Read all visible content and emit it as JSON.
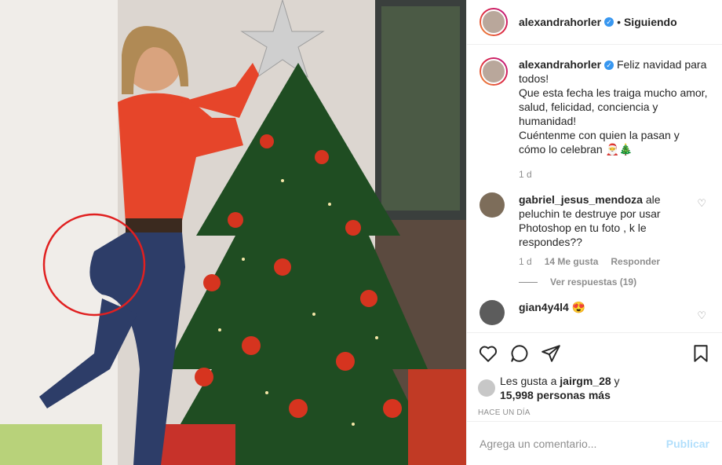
{
  "photo": {
    "alt": ""
  },
  "header": {
    "username": "alexandrahorler",
    "verified_icon": "verified-badge-icon",
    "separator": "•",
    "follow_label": "Siguiendo"
  },
  "caption": {
    "username": "alexandrahorler",
    "lines": [
      "Feliz navidad para",
      "todos!",
      "Que esta fecha les traiga mucho amor,",
      "salud, felicidad, conciencia y",
      "humanidad!",
      "Cuéntenme con quien la pasan y",
      "cómo lo celebran 🎅🎄"
    ],
    "time": "1 d"
  },
  "comments": [
    {
      "username": "gabriel_jesus_mendoza",
      "lines": [
        "ale",
        "peluchin te destruye por usar",
        "Photoshop en tu foto , k le",
        "respondes??"
      ],
      "time": "1 d",
      "likes": "14 Me gusta",
      "reply": "Responder",
      "view_replies": "Ver respuestas (19)"
    },
    {
      "username": "gian4y4l4",
      "text": "😍"
    }
  ],
  "actions": {
    "like_icon": "heart-icon",
    "comment_icon": "comment-icon",
    "share_icon": "share-icon",
    "save_icon": "bookmark-icon"
  },
  "likes": {
    "prefix": "Les gusta a ",
    "user": "jairgm_28",
    "suffix": " y",
    "line2": "15,998 personas más"
  },
  "date": "HACE UN DÍA",
  "add_comment": {
    "placeholder": "Agrega un comentario...",
    "publish": "Publicar"
  },
  "colors": {
    "verified": "#3897f0",
    "publish": "#b2dffc",
    "annotation_circle": "#e02020"
  }
}
